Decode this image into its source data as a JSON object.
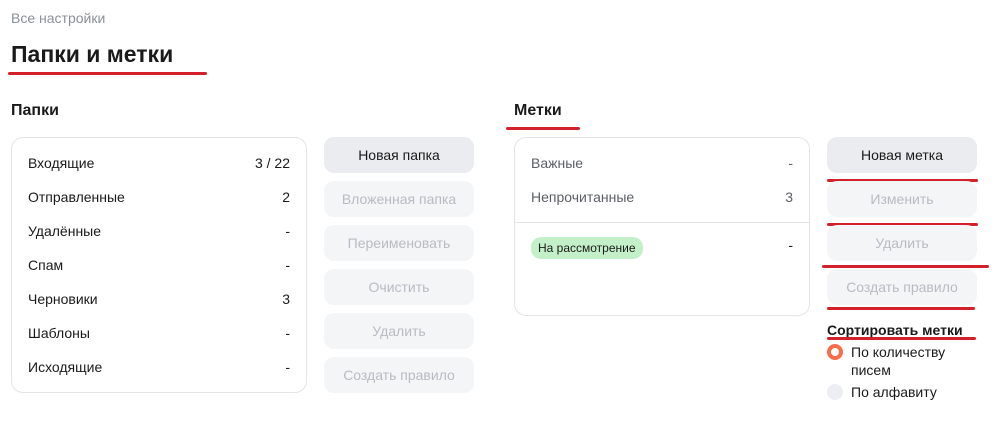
{
  "breadcrumb": "Все настройки",
  "page_title": "Папки и метки",
  "folders": {
    "title": "Папки",
    "items": [
      {
        "name": "Входящие",
        "count": "3 / 22"
      },
      {
        "name": "Отправленные",
        "count": "2"
      },
      {
        "name": "Удалённые",
        "count": "-"
      },
      {
        "name": "Спам",
        "count": "-"
      },
      {
        "name": "Черновики",
        "count": "3"
      },
      {
        "name": "Шаблоны",
        "count": "-"
      },
      {
        "name": "Исходящие",
        "count": "-"
      }
    ],
    "buttons": {
      "new": "Новая папка",
      "nested": "Вложенная папка",
      "rename": "Переименовать",
      "clear": "Очистить",
      "delete": "Удалить",
      "create_rule": "Создать правило"
    }
  },
  "labels": {
    "title": "Метки",
    "system": [
      {
        "name": "Важные",
        "count": "-"
      },
      {
        "name": "Непрочитанные",
        "count": "3"
      }
    ],
    "user": [
      {
        "name": "На рассмотрение",
        "count": "-",
        "color": "#c4f0c9"
      }
    ],
    "buttons": {
      "new": "Новая метка",
      "edit": "Изменить",
      "delete": "Удалить",
      "create_rule": "Создать правило"
    },
    "sort": {
      "title": "Сортировать метки",
      "options": [
        {
          "label": "По количеству писем",
          "selected": true
        },
        {
          "label": "По алфавиту",
          "selected": false
        }
      ]
    }
  },
  "colors": {
    "accent_red": "#d4202b",
    "radio_active": "#f96d4a",
    "label_badge": "#c4f0c9"
  }
}
